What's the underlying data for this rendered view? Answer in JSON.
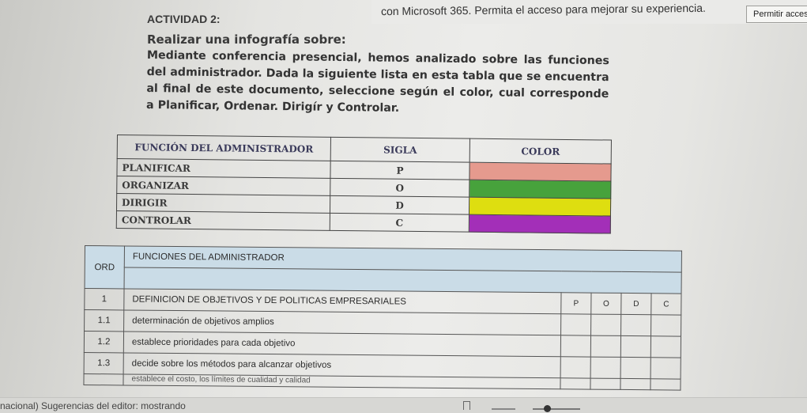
{
  "banner": {
    "text": "con Microsoft 365. Permita el acceso para mejorar su experiencia.",
    "button_label": "Permitir acceso"
  },
  "document": {
    "activity": "ACTIVIDAD 2:",
    "subtitle": "Realizar una infografía sobre:",
    "instructions": "Mediante conferencia presencial, hemos analizado sobre las funciones del administrador. Dada la siguiente lista en esta tabla que se encuentra al final de este documento, seleccione según el color, cual corresponde a Planificar, Ordenar. Dirigír y Controlar."
  },
  "table1": {
    "headers": [
      "FUNCIÓN DEL ADMINISTRADOR",
      "SIGLA",
      "COLOR"
    ],
    "rows": [
      {
        "funcion": "PLANIFICAR",
        "sigla": "P",
        "color": "#e59a8e"
      },
      {
        "funcion": "ORGANIZAR",
        "sigla": "O",
        "color": "#47a23c"
      },
      {
        "funcion": "DIRIGIR",
        "sigla": "D",
        "color": "#dede10"
      },
      {
        "funcion": "CONTROLAR",
        "sigla": "C",
        "color": "#a32fb8"
      }
    ]
  },
  "table2": {
    "header_ord": "ORD",
    "header_funciones": "FUNCIONES DEL ADMINISTRADOR",
    "letters": [
      "P",
      "O",
      "D",
      "C"
    ],
    "rows": [
      {
        "ord": "1",
        "text": "DEFINICION DE OBJETIVOS Y DE POLITICAS EMPRESARIALES"
      },
      {
        "ord": "1.1",
        "text": "determinación de objetivos amplios"
      },
      {
        "ord": "1.2",
        "text": "establece prioridades para cada objetivo"
      },
      {
        "ord": "1.3",
        "text": "decide sobre los métodos para alcanzar objetivos"
      }
    ],
    "cut_row_text": "establece el costo, los límites de cualidad y calidad"
  },
  "statusbar": {
    "text": "nacional)   Sugerencias del editor: mostrando"
  }
}
